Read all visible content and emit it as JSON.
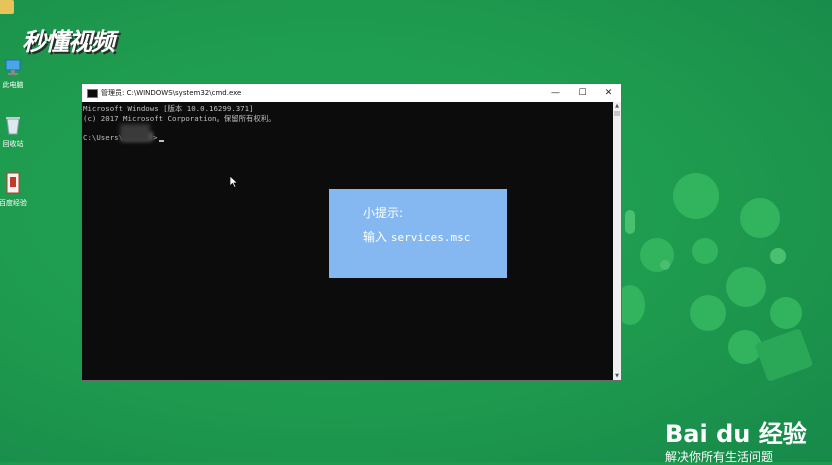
{
  "watermark_logo": "秒懂视频",
  "desktop": {
    "icons": [
      {
        "label": "此电脑"
      },
      {
        "label": "回收站"
      },
      {
        "label": "百度经验"
      }
    ]
  },
  "cmd_window": {
    "title": "管理员: C:\\WINDOWS\\system32\\cmd.exe",
    "controls": {
      "minimize": "—",
      "maximize": "☐",
      "close": "✕"
    },
    "lines": [
      "Microsoft Windows [版本 10.0.16299.371]",
      "(c) 2017 Microsoft Corporation。保留所有权利。",
      "",
      "C:\\Users\\"
    ],
    "prompt_suffix": ">",
    "background_color": "#0c0c0c",
    "text_color": "#c0c0c0"
  },
  "tip": {
    "title": "小提示:",
    "prefix": "输入",
    "command": "services.msc",
    "background_color": "#85b8f0"
  },
  "baidu_watermark": {
    "logo": "Bai du 经验",
    "tagline": "解决你所有生活问题"
  },
  "colors": {
    "desktop_bg": "#1e9a4e",
    "bubble": "#32b35e"
  }
}
